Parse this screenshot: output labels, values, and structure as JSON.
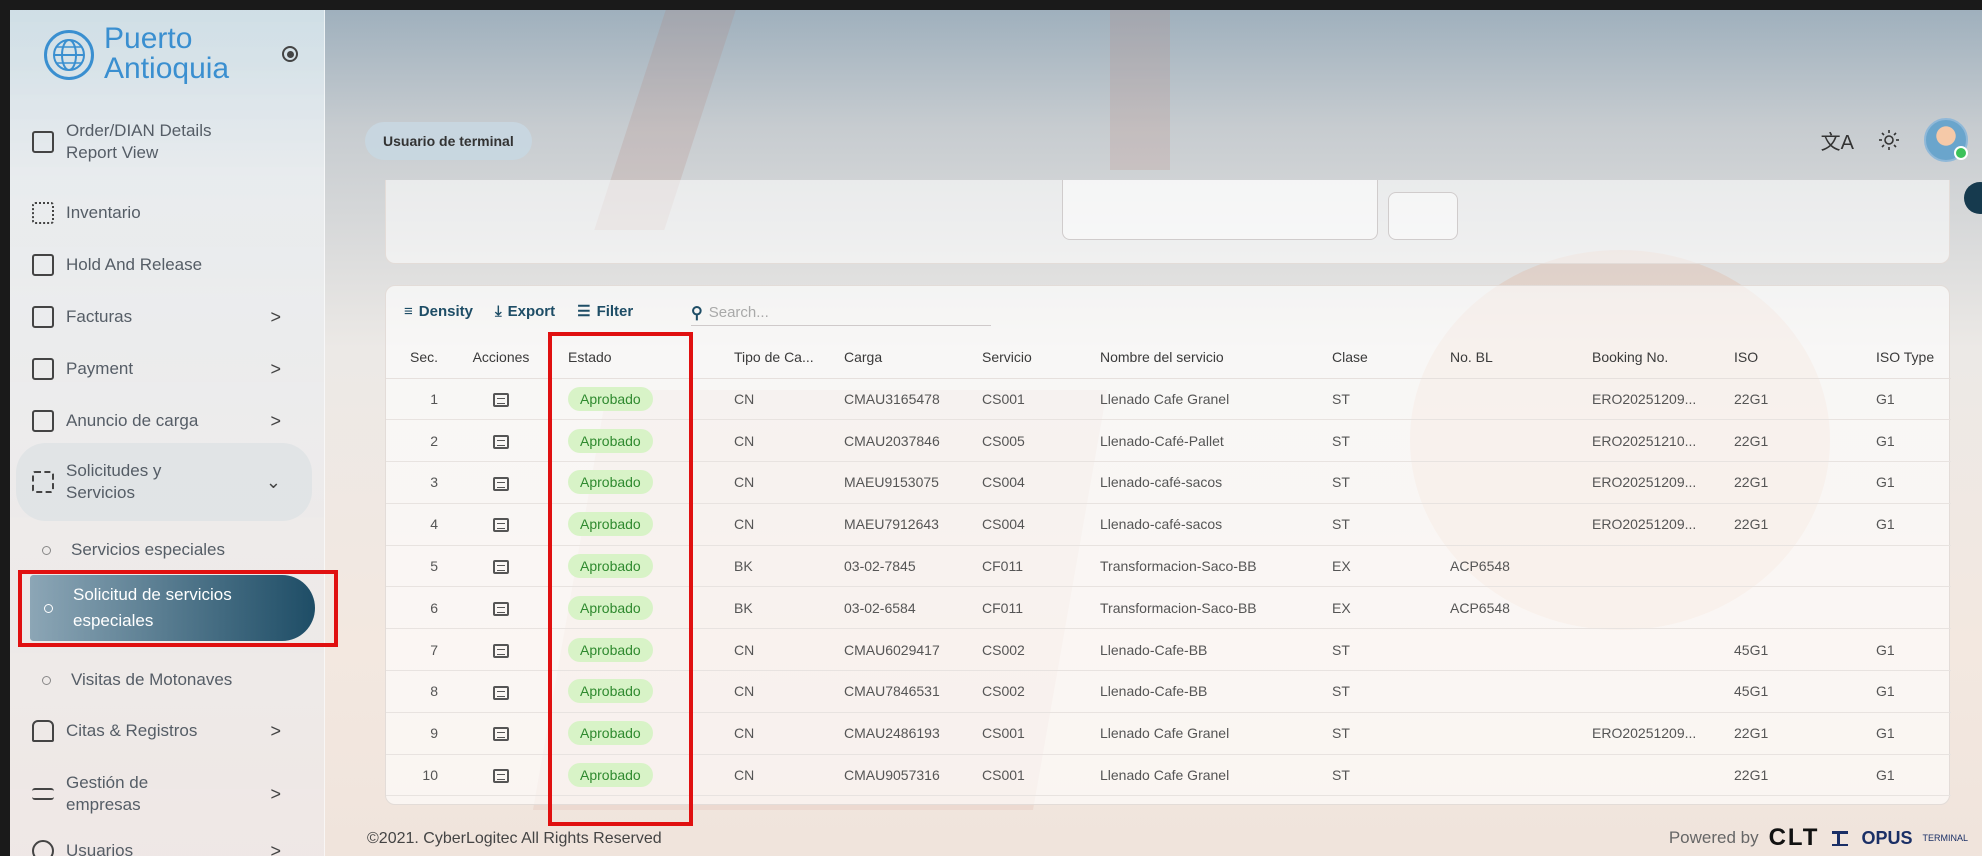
{
  "brand": {
    "line1": "Puerto",
    "line2": "Antioquia"
  },
  "sidebar": {
    "items": [
      {
        "label_line1": "Order/DIAN Details",
        "label_line2": "Report View",
        "icon": "chart-report-icon"
      },
      {
        "label": "Inventario",
        "icon": "grid-icon"
      },
      {
        "label": "Hold And Release",
        "icon": "folder-icon"
      },
      {
        "label": "Facturas",
        "icon": "document-icon",
        "chevron": ">"
      },
      {
        "label": "Payment",
        "icon": "card-icon",
        "chevron": ">"
      },
      {
        "label": "Anuncio de carga",
        "icon": "announce-icon",
        "chevron": ">"
      },
      {
        "label_line1": "Solicitudes y",
        "label_line2": "Servicios",
        "icon": "apps-plus-icon",
        "chevron": "⌄"
      },
      {
        "label": "Servicios especiales",
        "sub": true
      },
      {
        "label_line1": "Solicitud de servicios",
        "label_line2": "especiales",
        "sub": true,
        "active": true
      },
      {
        "label": "Visitas de Motonaves",
        "sub": true
      },
      {
        "label": "Citas & Registros",
        "icon": "car-icon",
        "chevron": ">"
      },
      {
        "label_line1": "Gestión de",
        "label_line2": "empresas",
        "icon": "sliders-icon",
        "chevron": ">"
      },
      {
        "label": "Usuarios",
        "icon": "user-icon",
        "chevron": ">"
      }
    ]
  },
  "header": {
    "role": "Usuario de terminal"
  },
  "toolbar": {
    "density": "Density",
    "export": "Export",
    "filter": "Filter",
    "search_placeholder": "Search..."
  },
  "table": {
    "columns": [
      "Sec.",
      "Acciones",
      "Estado",
      "Tipo de Ca...",
      "Carga",
      "Servicio",
      "Nombre del servicio",
      "Clase",
      "No. BL",
      "Booking No.",
      "ISO",
      "ISO Type"
    ],
    "rows": [
      {
        "sec": "1",
        "estado": "Aprobado",
        "tipo": "CN",
        "carga": "CMAU3165478",
        "servicio": "CS001",
        "nombre": "Llenado Cafe Granel",
        "clase": "ST",
        "bl": "",
        "booking": "ERO20251209...",
        "iso": "22G1",
        "iso_type": "G1"
      },
      {
        "sec": "2",
        "estado": "Aprobado",
        "tipo": "CN",
        "carga": "CMAU2037846",
        "servicio": "CS005",
        "nombre": "Llenado-Café-Pallet",
        "clase": "ST",
        "bl": "",
        "booking": "ERO20251210...",
        "iso": "22G1",
        "iso_type": "G1"
      },
      {
        "sec": "3",
        "estado": "Aprobado",
        "tipo": "CN",
        "carga": "MAEU9153075",
        "servicio": "CS004",
        "nombre": "Llenado-café-sacos",
        "clase": "ST",
        "bl": "",
        "booking": "ERO20251209...",
        "iso": "22G1",
        "iso_type": "G1"
      },
      {
        "sec": "4",
        "estado": "Aprobado",
        "tipo": "CN",
        "carga": "MAEU7912643",
        "servicio": "CS004",
        "nombre": "Llenado-café-sacos",
        "clase": "ST",
        "bl": "",
        "booking": "ERO20251209...",
        "iso": "22G1",
        "iso_type": "G1"
      },
      {
        "sec": "5",
        "estado": "Aprobado",
        "tipo": "BK",
        "carga": "03-02-7845",
        "servicio": "CF011",
        "nombre": "Transformacion-Saco-BB",
        "clase": "EX",
        "bl": "ACP6548",
        "booking": "",
        "iso": "",
        "iso_type": ""
      },
      {
        "sec": "6",
        "estado": "Aprobado",
        "tipo": "BK",
        "carga": "03-02-6584",
        "servicio": "CF011",
        "nombre": "Transformacion-Saco-BB",
        "clase": "EX",
        "bl": "ACP6548",
        "booking": "",
        "iso": "",
        "iso_type": ""
      },
      {
        "sec": "7",
        "estado": "Aprobado",
        "tipo": "CN",
        "carga": "CMAU6029417",
        "servicio": "CS002",
        "nombre": "Llenado-Cafe-BB",
        "clase": "ST",
        "bl": "",
        "booking": "",
        "iso": "45G1",
        "iso_type": "G1"
      },
      {
        "sec": "8",
        "estado": "Aprobado",
        "tipo": "CN",
        "carga": "CMAU7846531",
        "servicio": "CS002",
        "nombre": "Llenado-Cafe-BB",
        "clase": "ST",
        "bl": "",
        "booking": "",
        "iso": "45G1",
        "iso_type": "G1"
      },
      {
        "sec": "9",
        "estado": "Aprobado",
        "tipo": "CN",
        "carga": "CMAU2486193",
        "servicio": "CS001",
        "nombre": "Llenado Cafe Granel",
        "clase": "ST",
        "bl": "",
        "booking": "ERO20251209...",
        "iso": "22G1",
        "iso_type": "G1"
      },
      {
        "sec": "10",
        "estado": "Aprobado",
        "tipo": "CN",
        "carga": "CMAU9057316",
        "servicio": "CS001",
        "nombre": "Llenado Cafe Granel",
        "clase": "ST",
        "bl": "",
        "booking": "",
        "iso": "22G1",
        "iso_type": "G1"
      }
    ]
  },
  "footer": {
    "copyright": "©2021. CyberLogitec All Rights Reserved",
    "powered_by": "Powered by",
    "clt": "CLT",
    "opus": "OPUS",
    "terminal": "TERMINAL"
  },
  "colors": {
    "accent": "#3a8fd0",
    "active_nav": "#1e4d66",
    "badge_bg": "#d8f3c7",
    "badge_text": "#2f8a2f",
    "highlight": "#e01010"
  }
}
